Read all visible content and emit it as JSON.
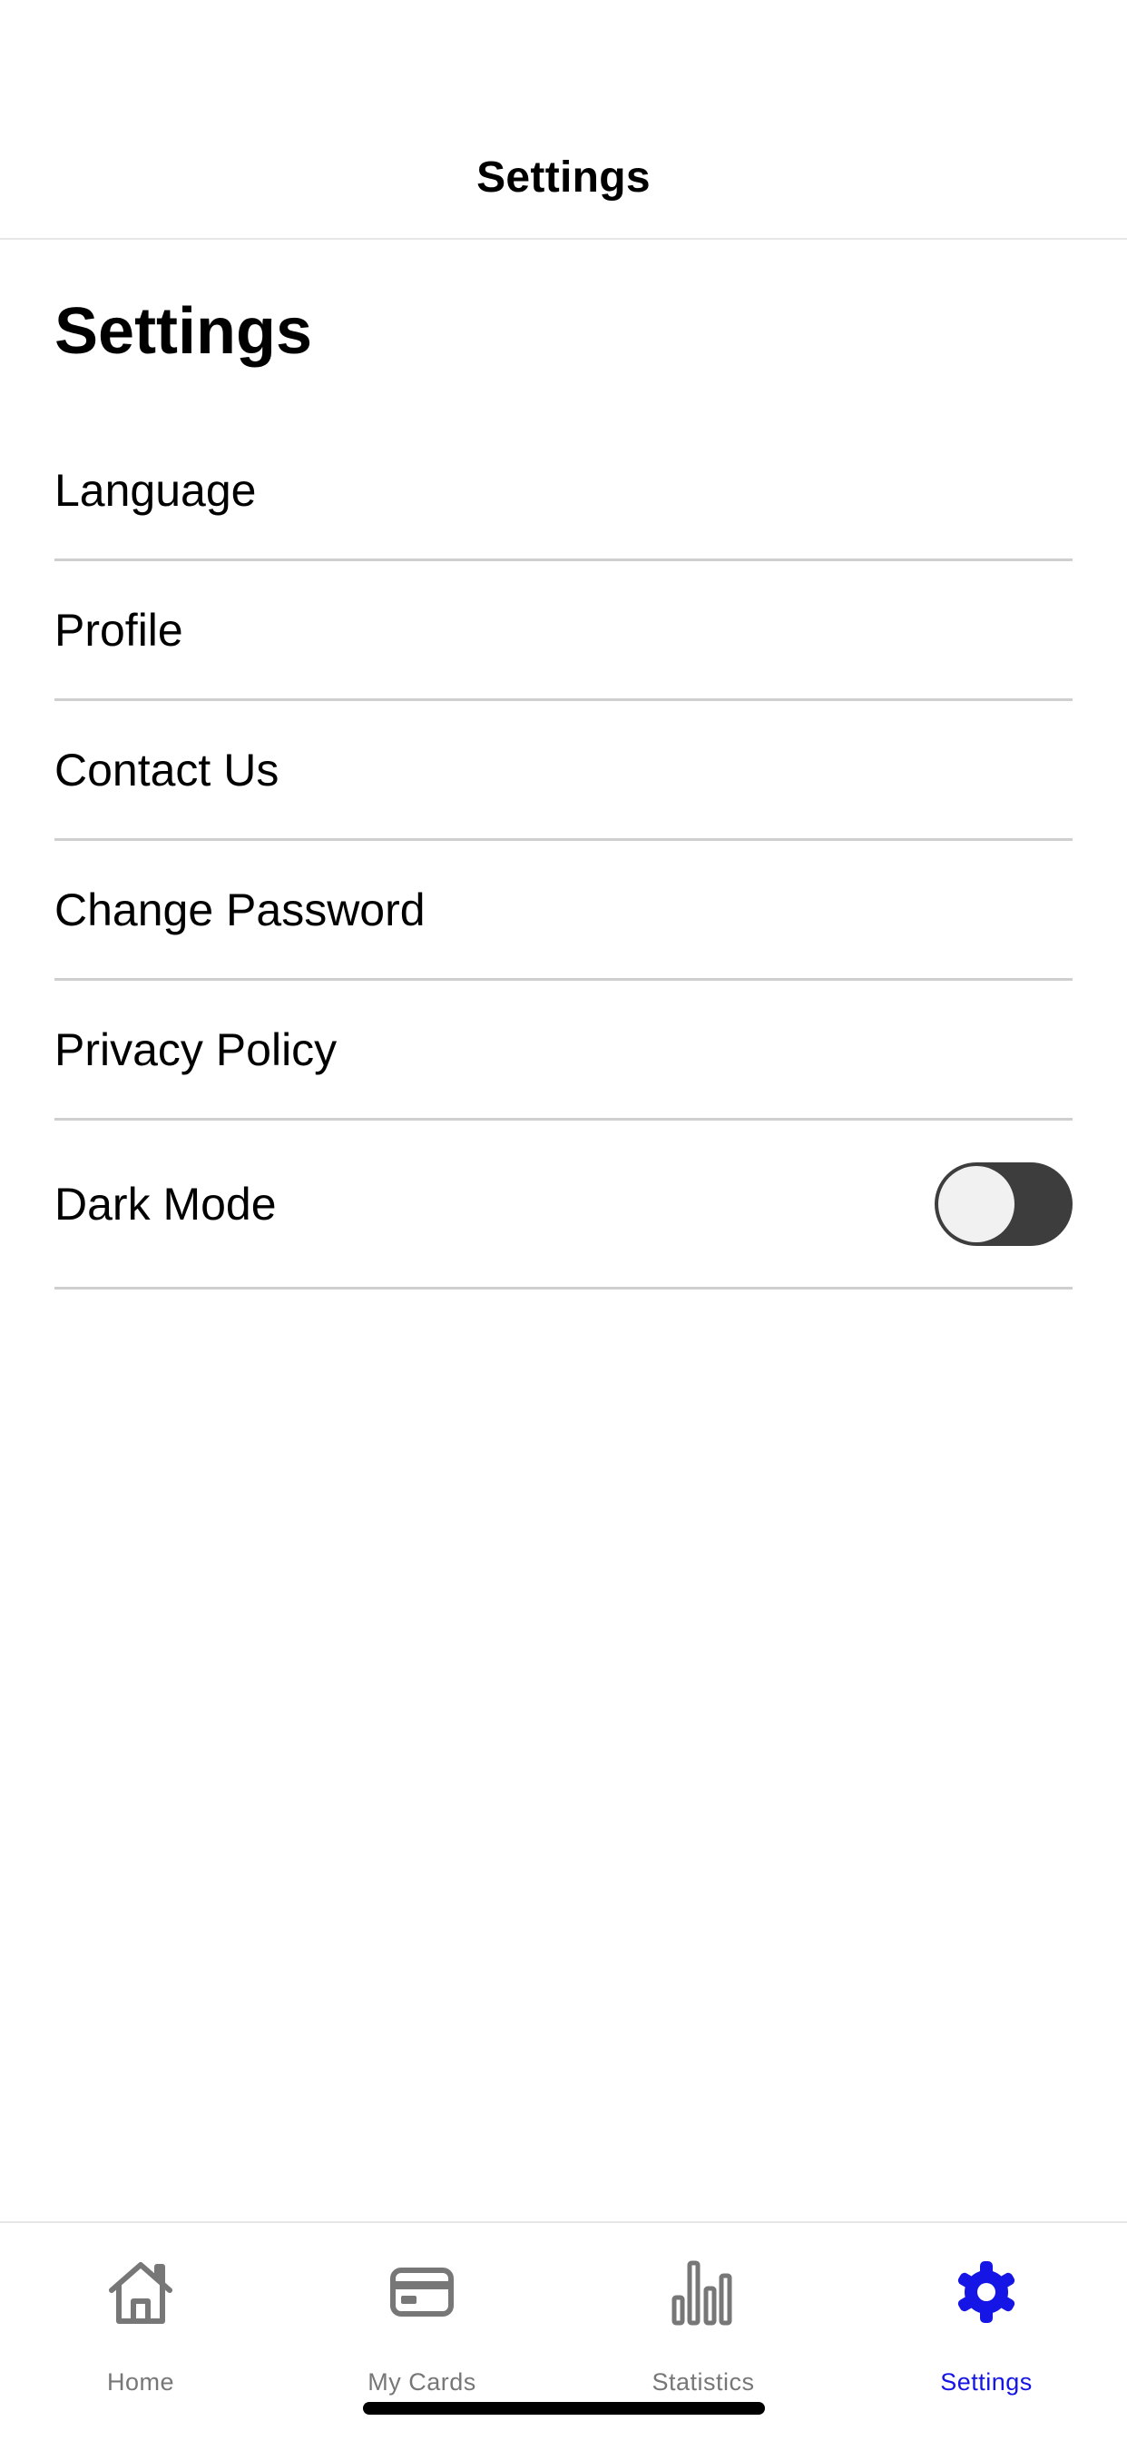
{
  "header": {
    "title": "Settings"
  },
  "page": {
    "heading": "Settings"
  },
  "settings": {
    "items": [
      {
        "label": "Language"
      },
      {
        "label": "Profile"
      },
      {
        "label": "Contact Us"
      },
      {
        "label": "Change Password"
      },
      {
        "label": "Privacy Policy"
      }
    ],
    "dark_mode": {
      "label": "Dark Mode",
      "enabled": false
    }
  },
  "tabbar": {
    "active_color": "#1515e6",
    "inactive_color": "#777777",
    "tabs": [
      {
        "label": "Home",
        "icon": "home-icon"
      },
      {
        "label": "My Cards",
        "icon": "card-icon"
      },
      {
        "label": "Statistics",
        "icon": "bar-chart-icon"
      },
      {
        "label": "Settings",
        "icon": "gear-icon",
        "active": true
      }
    ]
  }
}
